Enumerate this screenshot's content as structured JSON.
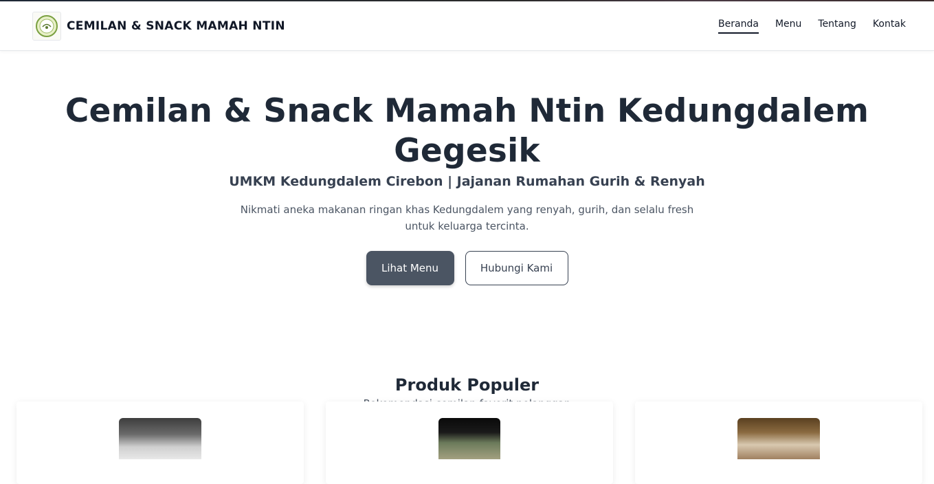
{
  "header": {
    "brand_name": "CEMILAN & SNACK MAMAH NTIN",
    "logo_icon": "brand-logo",
    "nav": [
      "Beranda",
      "Menu",
      "Tentang",
      "Kontak"
    ],
    "active_nav": "Beranda"
  },
  "hero": {
    "title": "Cemilan & Snack Mamah Ntin Kedungdalem Gegesik",
    "subtitle": "UMKM Kedungdalem Cirebon | Jajanan Rumahan Gurih & Renyah",
    "description": "Nikmati aneka makanan ringan khas Kedungdalem yang renyah, gurih, dan selalu fresh untuk keluarga tercinta.",
    "primary_cta": "Lihat Menu",
    "secondary_cta": "Hubungi Kami"
  },
  "popular": {
    "title": "Produk Populer",
    "subtitle": "Rekomendasi cemilan favorit pelanggan",
    "cards": 3
  },
  "colors": {
    "text_dark": "#1f2937",
    "button_primary": "#4b5563",
    "accent_border": "#374151"
  }
}
